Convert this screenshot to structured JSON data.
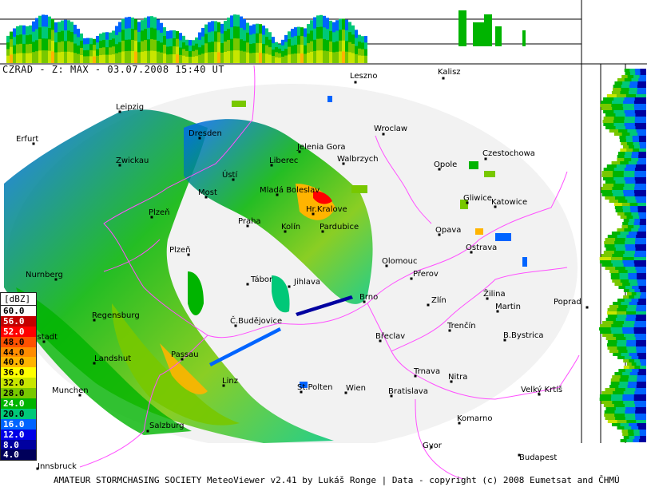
{
  "title": "CZRAD - Z: MAX - 03.07.2008 15:40 UT",
  "footer": {
    "credit": "AMATEUR STORMCHASING SOCIETY MeteoViewer v2.41 by Lukáš Ronge | Data - copyright (c) 2008 Eumetsat and ČHMÚ"
  },
  "legend": {
    "unit": "[dBZ]",
    "levels": [
      {
        "label": "60.0",
        "color": "#ffffff"
      },
      {
        "label": "56.0",
        "color": "#c40000"
      },
      {
        "label": "52.0",
        "color": "#ff0000"
      },
      {
        "label": "48.0",
        "color": "#ff5000"
      },
      {
        "label": "44.0",
        "color": "#ff8c00"
      },
      {
        "label": "40.0",
        "color": "#ffb400"
      },
      {
        "label": "36.0",
        "color": "#ffff00"
      },
      {
        "label": "32.0",
        "color": "#c8e600"
      },
      {
        "label": "28.0",
        "color": "#78c800"
      },
      {
        "label": "24.0",
        "color": "#00b400"
      },
      {
        "label": "20.0",
        "color": "#00c878"
      },
      {
        "label": "16.0",
        "color": "#0064ff"
      },
      {
        "label": "12.0",
        "color": "#0000e6"
      },
      {
        "label": "8.0",
        "color": "#0000a0"
      },
      {
        "label": "4.0",
        "color": "#00005a"
      }
    ]
  },
  "cities": [
    {
      "name": "Leszno"
    },
    {
      "name": "Kalisz"
    },
    {
      "name": "Leipzig"
    },
    {
      "name": "Wroclaw"
    },
    {
      "name": "Erfurt"
    },
    {
      "name": "Dresden"
    },
    {
      "name": "Jelenia Gora"
    },
    {
      "name": "Walbrzych"
    },
    {
      "name": "Czestochowa"
    },
    {
      "name": "Zwickau"
    },
    {
      "name": "Liberec"
    },
    {
      "name": "Opole"
    },
    {
      "name": "Ústí"
    },
    {
      "name": "Most"
    },
    {
      "name": "Mladá Boleslav"
    },
    {
      "name": "Gliwice"
    },
    {
      "name": "Katowice"
    },
    {
      "name": "Hr.Kralove"
    },
    {
      "name": "Plzeň"
    },
    {
      "name": "Praha"
    },
    {
      "name": "Kolín"
    },
    {
      "name": "Pardubice"
    },
    {
      "name": "Opava"
    },
    {
      "name": "Ostrava"
    },
    {
      "name": "Plzeň"
    },
    {
      "name": "Olomouc"
    },
    {
      "name": "Přerov"
    },
    {
      "name": "Nurnberg"
    },
    {
      "name": "Tábor"
    },
    {
      "name": "Jihlava"
    },
    {
      "name": "Brno"
    },
    {
      "name": "Zlín"
    },
    {
      "name": "Žilina"
    },
    {
      "name": "Martin"
    },
    {
      "name": "Poprad"
    },
    {
      "name": "Regensburg"
    },
    {
      "name": "Č.Budějovice"
    },
    {
      "name": "Trenčín"
    },
    {
      "name": "Břeclav"
    },
    {
      "name": "B.Bystrica"
    },
    {
      "name": "Ingolstadt"
    },
    {
      "name": "Landshut"
    },
    {
      "name": "Passau"
    },
    {
      "name": "Trnava"
    },
    {
      "name": "Nitra"
    },
    {
      "name": "Linz"
    },
    {
      "name": "Munchen"
    },
    {
      "name": "St.Polten"
    },
    {
      "name": "Wien"
    },
    {
      "name": "Bratislava"
    },
    {
      "name": "Velký Krtíš"
    },
    {
      "name": "Salzburg"
    },
    {
      "name": "Komarno"
    },
    {
      "name": "Gyor"
    },
    {
      "name": "Budapest"
    },
    {
      "name": "Innsbruck"
    }
  ]
}
